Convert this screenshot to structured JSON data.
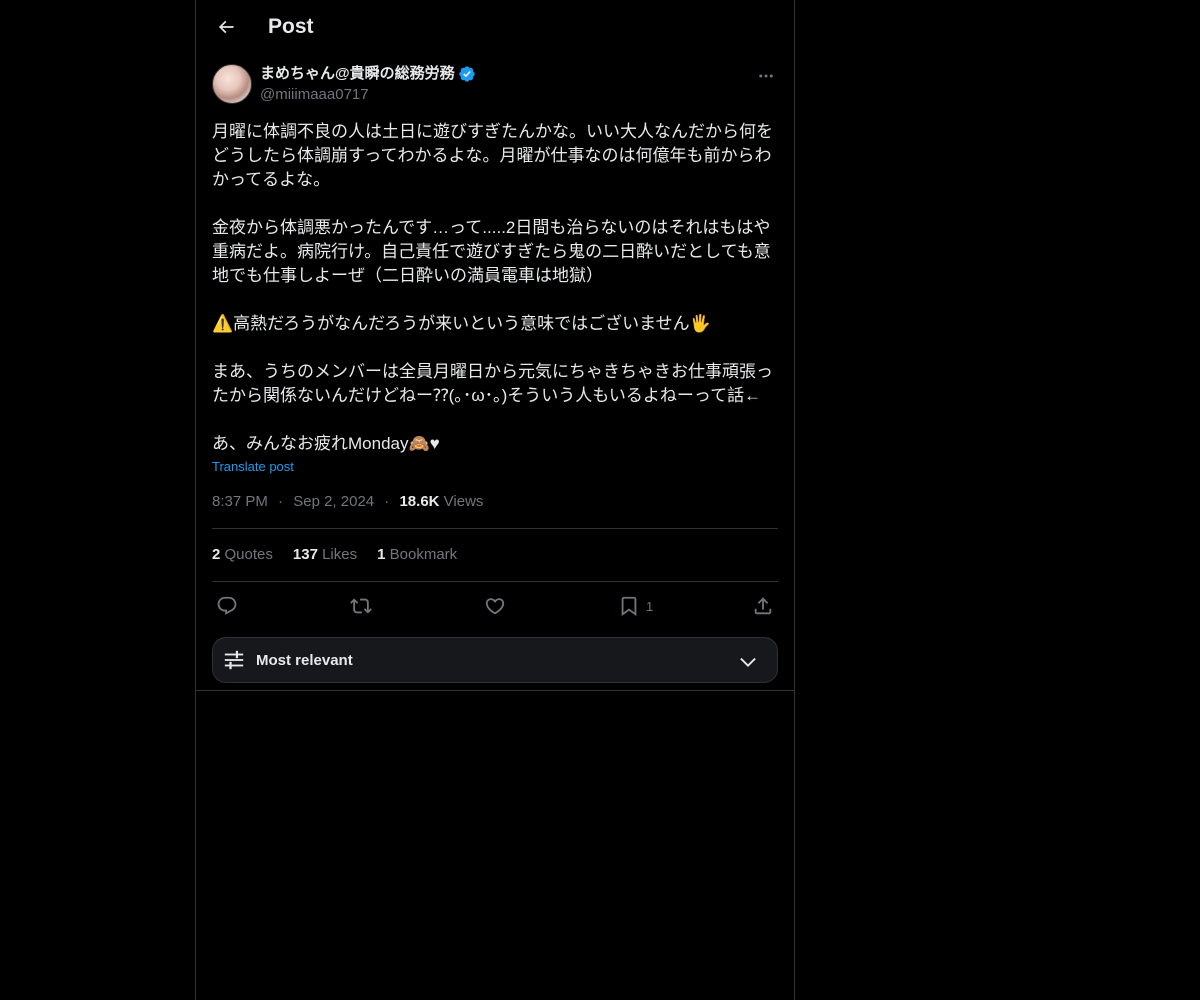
{
  "header": {
    "title": "Post"
  },
  "post": {
    "author": {
      "display_name": "まめちゃん@貴瞬の総務労務",
      "handle": "@miiimaaa0717",
      "verified": true
    },
    "paragraphs": [
      "月曜に体調不良の人は土日に遊びすぎたんかな。いい大人なんだから何をどうしたら体調崩すってわかるよな。月曜が仕事なのは何億年も前からわかってるよな。",
      "金夜から体調悪かったんです…って.....2日間も治らないのはそれはもはや重病だよ。病院行け。自己責任で遊びすぎたら鬼の二日酔いだとしても意地でも仕事しよーぜ（二日酔いの満員電車は地獄）",
      "⚠️高熱だろうがなんだろうが来いという意味ではございません🖐",
      "まあ、うちのメンバーは全員月曜日から元気にちゃきちゃきお仕事頑張ったから関係ないんだけどねー⁇(｡･ω･｡)そういう人もいるよねーって話←",
      "あ、みんなお疲れMonday🙈♥"
    ],
    "translate_label": "Translate post",
    "time": "8:37 PM",
    "date": "Sep 2, 2024",
    "views_count": "18.6K",
    "views_label": "Views",
    "separator": "·"
  },
  "stats": {
    "quotes_count": "2",
    "quotes_label": "Quotes",
    "likes_count": "137",
    "likes_label": "Likes",
    "bookmarks_count": "1",
    "bookmarks_label": "Bookmark"
  },
  "actions": {
    "reply_icon": "reply-icon",
    "repost_icon": "repost-icon",
    "like_icon": "heart-icon",
    "bookmark_icon": "bookmark-icon",
    "bookmark_count": "1",
    "share_icon": "share-icon"
  },
  "sort": {
    "label": "Most relevant"
  },
  "colors": {
    "background": "#000000",
    "text": "#e7e9ea",
    "secondary": "#71767b",
    "link": "#1d9bf0",
    "verified": "#1d9bf0",
    "border": "#2f3336"
  }
}
